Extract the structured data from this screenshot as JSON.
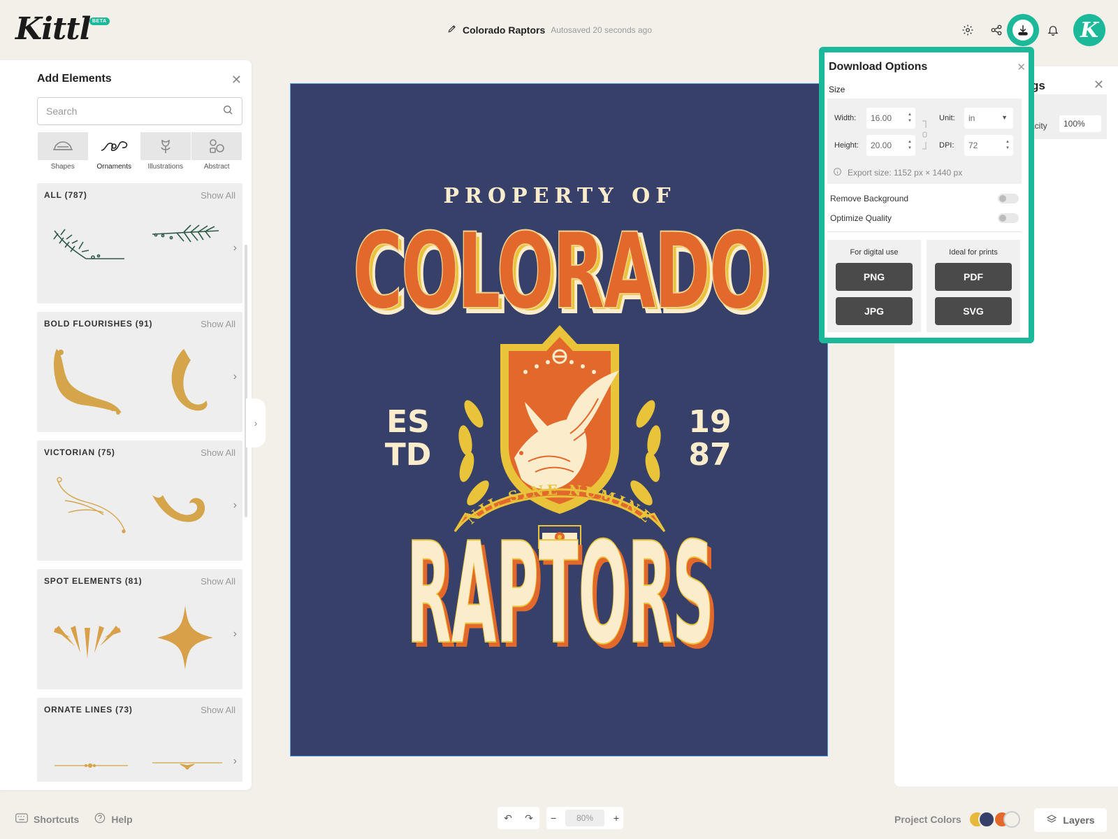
{
  "app": {
    "logo": "Kittl",
    "badge": "BETA"
  },
  "header": {
    "doc_title": "Colorado Raptors",
    "autosave": "Autosaved 20 seconds ago",
    "icons": [
      "gear-icon",
      "share-icon",
      "download-icon",
      "bell-icon"
    ],
    "avatar_letter": "K",
    "accent_color": "#1bb99a"
  },
  "add_elements": {
    "title": "Add Elements",
    "search": {
      "placeholder": "Search",
      "value": ""
    },
    "categories": [
      {
        "label": "Shapes",
        "active": false
      },
      {
        "label": "Ornaments",
        "active": true
      },
      {
        "label": "Illustrations",
        "active": false
      },
      {
        "label": "Abstract",
        "active": false
      }
    ],
    "show_all_label": "Show All",
    "sections": [
      {
        "title": "ALL (787)"
      },
      {
        "title": "BOLD FLOURISHES (91)"
      },
      {
        "title": "VICTORIAN (75)"
      },
      {
        "title": "SPOT ELEMENTS (81)"
      },
      {
        "title": "ORNATE LINES (73)"
      }
    ]
  },
  "rail_icons": [
    "edit-icon",
    "layout-icon",
    "text-icon",
    "elements-icon",
    "upload-icon",
    "camera-icon",
    "pattern-icon"
  ],
  "canvas": {
    "background_color": "#374069",
    "texts": {
      "property_of": "PROPERTY OF",
      "colorado": "COLORADO",
      "est_1": "ES",
      "est_2": "TD",
      "year_1": "19",
      "year_2": "87",
      "motto": "NIL SINE NUMINE",
      "raptors": "RAPTORS"
    }
  },
  "right_panel": {
    "title_fragment": "gs",
    "opacity_label_fragment": "acity",
    "opacity_value": "100%"
  },
  "download": {
    "title": "Download Options",
    "size_label": "Size",
    "width_label": "Width:",
    "width_value": "16.00",
    "height_label": "Height:",
    "height_value": "20.00",
    "unit_label": "Unit:",
    "unit_value": "in",
    "dpi_label": "DPI:",
    "dpi_value": "72",
    "export_size": "Export size: 1152 px × 1440 px",
    "remove_background": "Remove Background",
    "optimize_quality": "Optimize Quality",
    "digital_heading": "For digital use",
    "print_heading": "Ideal for prints",
    "buttons": {
      "png": "PNG",
      "jpg": "JPG",
      "pdf": "PDF",
      "svg": "SVG"
    }
  },
  "footer": {
    "shortcuts": "Shortcuts",
    "help": "Help",
    "zoom": "80%",
    "project_colors": "Project Colors",
    "swatch_colors": [
      "#e7b93a",
      "#374069",
      "#e2682b",
      "#f3f0ea"
    ],
    "layers": "Layers"
  }
}
